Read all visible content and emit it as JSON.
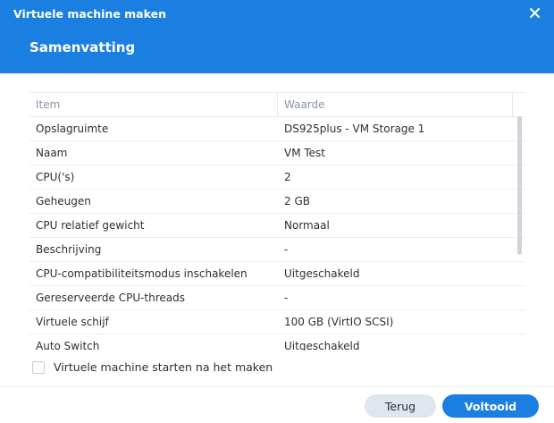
{
  "window": {
    "title": "Virtuele machine maken"
  },
  "page": {
    "title": "Samenvatting"
  },
  "table": {
    "headers": [
      "Item",
      "Waarde"
    ],
    "rows": [
      [
        "Opslagruimte",
        "DS925plus - VM Storage 1"
      ],
      [
        "Naam",
        "VM Test"
      ],
      [
        "CPU('s)",
        "2"
      ],
      [
        "Geheugen",
        "2 GB"
      ],
      [
        "CPU relatief gewicht",
        "Normaal"
      ],
      [
        "Beschrijving",
        "-"
      ],
      [
        "CPU-compatibiliteitsmodus inschakelen",
        "Uitgeschakeld"
      ],
      [
        "Gereserveerde CPU-threads",
        "-"
      ],
      [
        "Virtuele schijf",
        "100 GB (VirtIO SCSI)"
      ],
      [
        "Auto Switch",
        "Uitgeschakeld"
      ]
    ]
  },
  "options": {
    "start_after_create_label": "Virtuele machine starten na het maken",
    "start_after_create_checked": false
  },
  "footer": {
    "back_label": "Terug",
    "finish_label": "Voltooid"
  },
  "colors": {
    "accent": "#1a7fe0",
    "secondary_button": "#dfe6ef"
  },
  "icons": {
    "close": "close-icon"
  }
}
